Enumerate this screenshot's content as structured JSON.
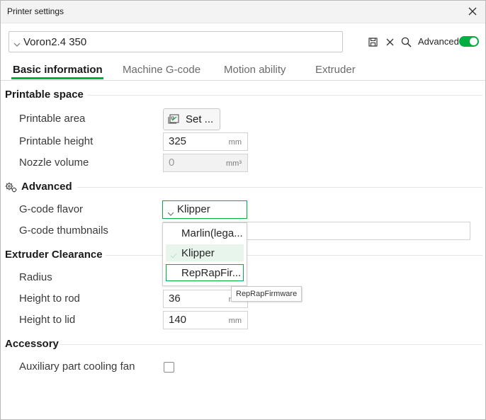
{
  "window": {
    "title": "Printer settings"
  },
  "toolbar": {
    "preset_value": "Voron2.4 350",
    "advanced_label": "Advanced",
    "advanced_enabled": true
  },
  "tabs": [
    {
      "label": "Basic information",
      "active": true
    },
    {
      "label": "Machine G-code",
      "active": false
    },
    {
      "label": "Motion ability",
      "active": false
    },
    {
      "label": "Extruder",
      "active": false
    }
  ],
  "sections": {
    "printable_space": {
      "title": "Printable space",
      "printable_area_label": "Printable area",
      "set_button_label": "Set ...",
      "printable_height_label": "Printable height",
      "printable_height_value": "325",
      "printable_height_unit": "mm",
      "nozzle_volume_label": "Nozzle volume",
      "nozzle_volume_value": "0",
      "nozzle_volume_unit": "mm³"
    },
    "advanced": {
      "title": "Advanced",
      "gcode_flavor_label": "G-code flavor",
      "gcode_flavor_value": "Klipper",
      "gcode_thumbnails_label": "G-code thumbnails"
    },
    "extruder_clearance": {
      "title": "Extruder Clearance",
      "radius_label": "Radius",
      "height_to_rod_label": "Height to rod",
      "height_to_rod_value": "36",
      "height_to_rod_unit": "mm",
      "height_to_lid_label": "Height to lid",
      "height_to_lid_value": "140",
      "height_to_lid_unit": "mm"
    },
    "accessory": {
      "title": "Accessory",
      "aux_fan_label": "Auxiliary part cooling fan",
      "aux_fan_checked": false
    }
  },
  "dropdown": {
    "options": [
      {
        "label": "Marlin(lega..."
      },
      {
        "label": "Klipper"
      },
      {
        "label": "RepRapFir..."
      }
    ],
    "selected": "Klipper",
    "tooltip": "RepRapFirmware"
  },
  "colors": {
    "accent": "#00ae42"
  }
}
